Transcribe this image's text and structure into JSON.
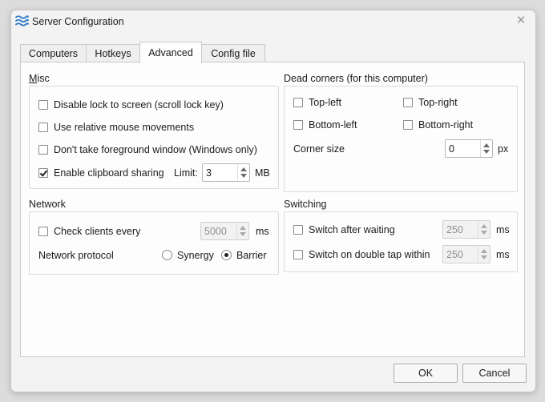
{
  "window": {
    "title": "Server Configuration",
    "close_glyph": "✕"
  },
  "tabs": [
    {
      "label": "Computers"
    },
    {
      "label": "Hotkeys"
    },
    {
      "label": "Advanced"
    },
    {
      "label": "Config file"
    }
  ],
  "misc": {
    "label": "Misc",
    "disable_lock": {
      "label": "Disable lock to screen (scroll lock key)",
      "checked": false
    },
    "relative_mouse": {
      "label": "Use relative mouse movements",
      "checked": false
    },
    "foreground": {
      "label": "Don't take foreground window (Windows only)",
      "checked": false
    },
    "clipboard": {
      "label": "Enable clipboard sharing",
      "checked": true,
      "limit_label": "Limit:",
      "limit_value": "3",
      "limit_unit": "MB"
    }
  },
  "dead_corners": {
    "label": "Dead corners (for this computer)",
    "top_left": "Top-left",
    "top_right": "Top-right",
    "bottom_left": "Bottom-left",
    "bottom_right": "Bottom-right",
    "corner_size_label": "Corner size",
    "corner_size_value": "0",
    "corner_size_unit": "px"
  },
  "network": {
    "label": "Network",
    "check_clients_label": "Check clients every",
    "check_clients_value": "5000",
    "check_clients_unit": "ms",
    "protocol_label": "Network protocol",
    "protocol_synergy": "Synergy",
    "protocol_barrier": "Barrier",
    "protocol_selected": "Barrier"
  },
  "switching": {
    "label": "Switching",
    "after_waiting_label": "Switch after waiting",
    "after_waiting_value": "250",
    "after_waiting_unit": "ms",
    "double_tap_label": "Switch on double tap within",
    "double_tap_value": "250",
    "double_tap_unit": "ms"
  },
  "buttons": {
    "ok": "OK",
    "cancel": "Cancel"
  },
  "colors": {
    "accent": "#2a78c8",
    "window_bg": "#f3f3f3",
    "panel_bg": "#fdfdfd"
  },
  "icons": {
    "app": "barrier-waves-icon",
    "close": "close-icon"
  }
}
